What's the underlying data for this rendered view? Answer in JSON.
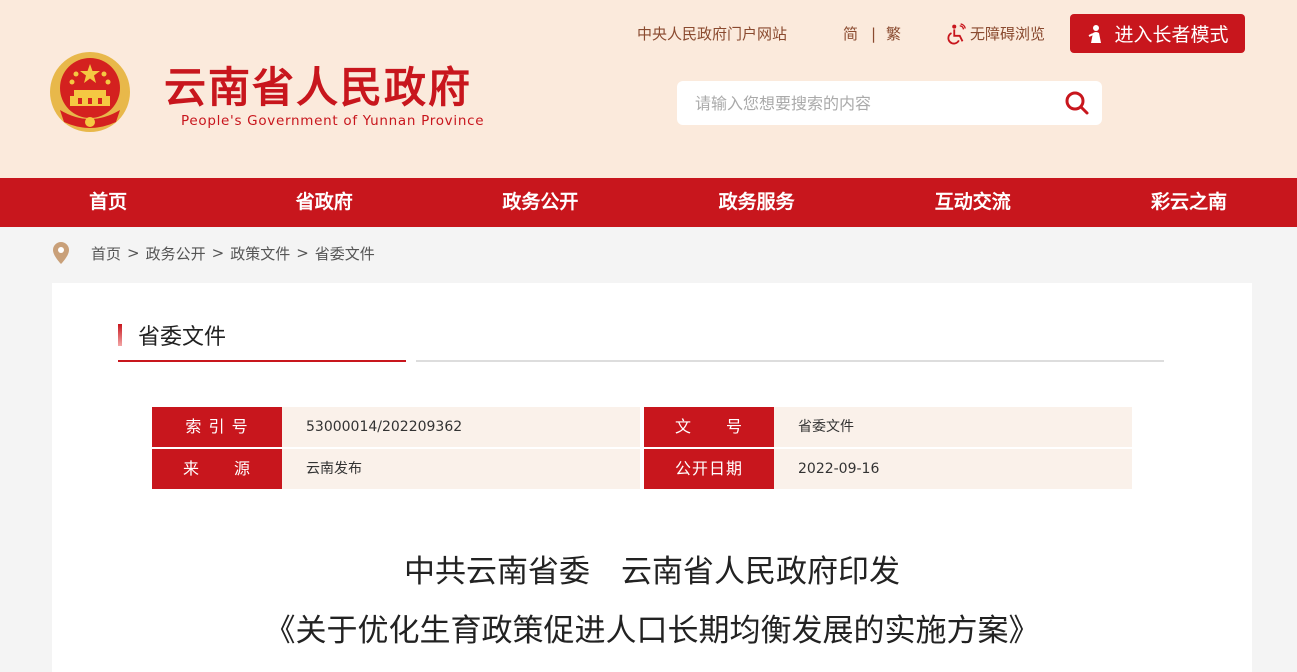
{
  "header": {
    "title": "云南省人民政府",
    "subtitle": "People's Government of Yunnan Province",
    "links": {
      "portal": "中央人民政府门户网站",
      "simplified": "简",
      "separator": "|",
      "traditional": "繁",
      "accessibility": "无障碍浏览"
    },
    "elder_mode": "进入长者模式",
    "search": {
      "placeholder": "请输入您想要搜索的内容"
    }
  },
  "nav": {
    "items": [
      "首页",
      "省政府",
      "政务公开",
      "政务服务",
      "互动交流",
      "彩云之南"
    ]
  },
  "breadcrumb": {
    "items": [
      "首页",
      "政务公开",
      "政策文件",
      "省委文件"
    ],
    "separator": ">"
  },
  "section": {
    "title": "省委文件"
  },
  "meta": {
    "index_no_label": "索 引 号",
    "index_no": "53000014/202209362",
    "doc_no_label": "文　　号",
    "doc_no": "省委文件",
    "source_label": "来　　源",
    "source": "云南发布",
    "date_label": "公开日期",
    "date": "2022-09-16"
  },
  "document": {
    "title_line1": "中共云南省委　云南省人民政府印发",
    "title_line2": "《关于优化生育政策促进人口长期均衡发展的实施方案》"
  },
  "colors": {
    "brand_red": "#c8161d",
    "header_bg": "#fbeadc",
    "meta_bg": "#faf1ea"
  }
}
